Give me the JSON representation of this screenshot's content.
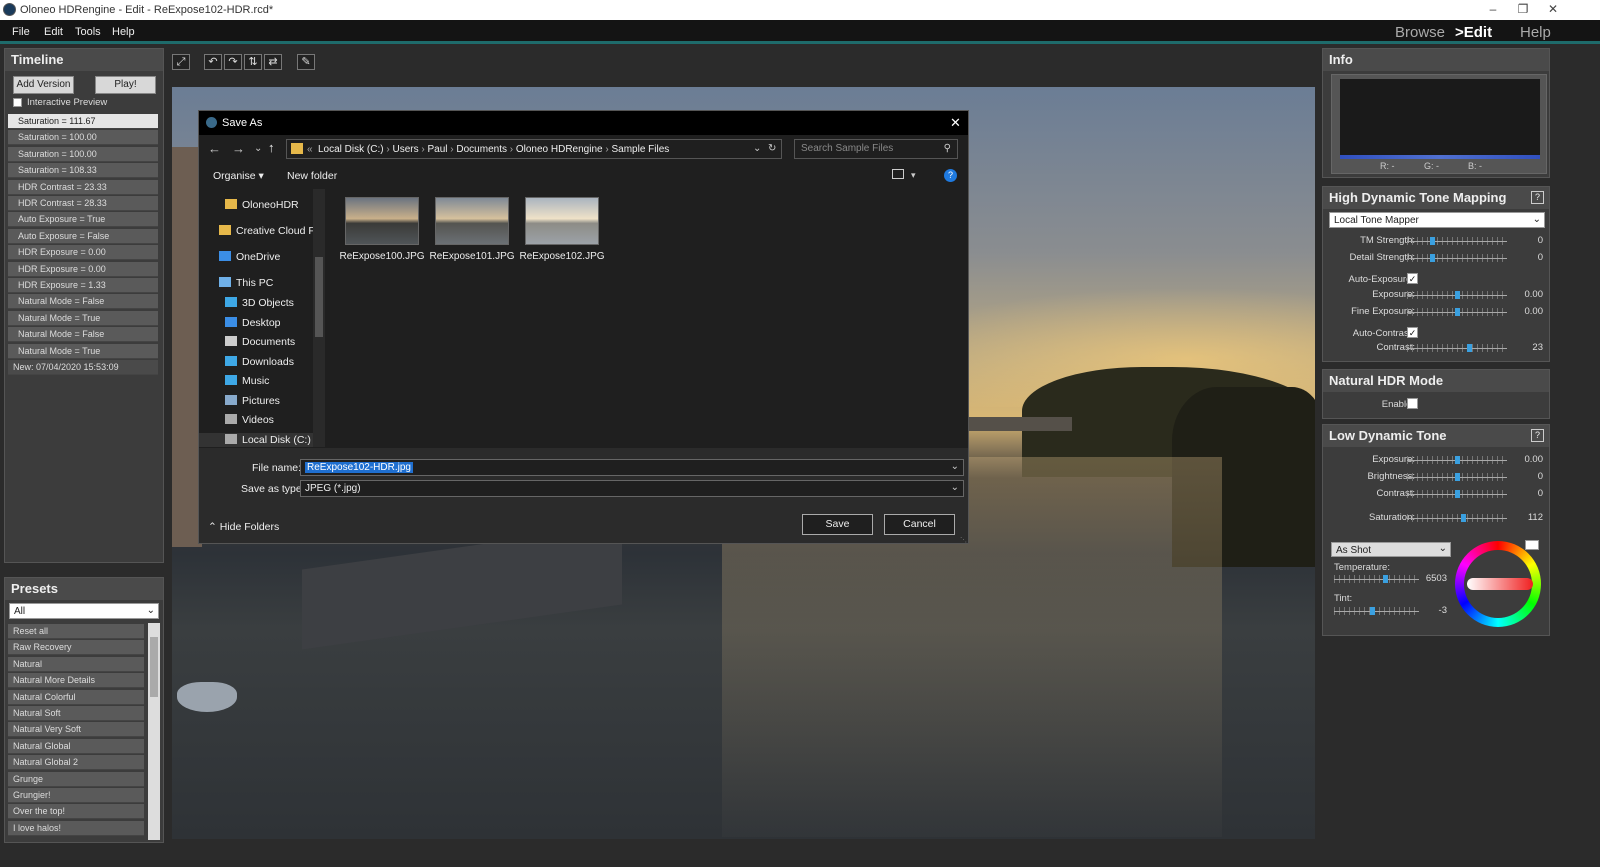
{
  "window": {
    "title": "Oloneo HDRengine - Edit - ReExpose102-HDR.rcd*"
  },
  "menu": {
    "items": [
      "File",
      "Edit",
      "Tools",
      "Help"
    ]
  },
  "modes": {
    "browse": "Browse",
    "edit": ">Edit",
    "help": "Help"
  },
  "timeline": {
    "title": "Timeline",
    "add_version": "Add Version",
    "play": "Play!",
    "interactive_preview": "Interactive Preview",
    "items": [
      "Saturation = 111.67",
      "Saturation = 100.00",
      "Saturation = 100.00",
      "Saturation = 108.33",
      "HDR Contrast = 23.33",
      "HDR Contrast = 28.33",
      "Auto Exposure = True",
      "Auto Exposure = False",
      "HDR Exposure = 0.00",
      "HDR Exposure = 0.00",
      "HDR Exposure = 1.33",
      "Natural Mode = False",
      "Natural Mode = True",
      "Natural Mode = False",
      "Natural Mode = True",
      "New: 07/04/2020 15:53:09"
    ]
  },
  "presets": {
    "title": "Presets",
    "filter": "All",
    "items": [
      "Reset all",
      "Raw Recovery",
      "Natural",
      "Natural More Details",
      "Natural Colorful",
      "Natural Soft",
      "Natural Very Soft",
      "Natural Global",
      "Natural Global 2",
      "Grunge",
      "Grungier!",
      "Over the top!",
      "I love halos!"
    ]
  },
  "dialog": {
    "title": "Save As",
    "breadcrumb": [
      "Local Disk (C:)",
      "Users",
      "Paul",
      "Documents",
      "Oloneo HDRengine",
      "Sample Files"
    ],
    "search_placeholder": "Search Sample Files",
    "organise": "Organise",
    "new_folder": "New folder",
    "nav": [
      "OloneoHDR",
      "Creative Cloud Fil",
      "OneDrive",
      "This PC",
      "3D Objects",
      "Desktop",
      "Documents",
      "Downloads",
      "Music",
      "Pictures",
      "Videos",
      "Local Disk (C:)"
    ],
    "files": [
      "ReExpose100.JPG",
      "ReExpose101.JPG",
      "ReExpose102.JPG"
    ],
    "file_name_label": "File name:",
    "file_name": "ReExpose102-HDR.jpg",
    "save_type_label": "Save as type:",
    "save_type": "JPEG (*.jpg)",
    "hide_folders": "Hide Folders",
    "save": "Save",
    "cancel": "Cancel"
  },
  "info": {
    "title": "Info",
    "r": "R: -",
    "g": "G: -",
    "b": "B: -"
  },
  "hdtm": {
    "title": "High Dynamic Tone Mapping",
    "mapper": "Local Tone Mapper",
    "tm_strength": {
      "label": "TM Strength:",
      "value": "0",
      "pos": 0.25
    },
    "detail_strength": {
      "label": "Detail Strength:",
      "value": "0",
      "pos": 0.25
    },
    "auto_exposure": "Auto-Exposure:",
    "exposure": {
      "label": "Exposure:",
      "value": "0.00",
      "pos": 0.5
    },
    "fine_exposure": {
      "label": "Fine Exposure:",
      "value": "0.00",
      "pos": 0.5
    },
    "auto_contrast": "Auto-Contrast:",
    "contrast": {
      "label": "Contrast:",
      "value": "23",
      "pos": 0.62
    }
  },
  "natural": {
    "title": "Natural HDR Mode",
    "enable": "Enable:"
  },
  "ldt": {
    "title": "Low Dynamic Tone",
    "exposure": {
      "label": "Exposure:",
      "value": "0.00",
      "pos": 0.5
    },
    "brightness": {
      "label": "Brightness:",
      "value": "0",
      "pos": 0.5
    },
    "contrast": {
      "label": "Contrast:",
      "value": "0",
      "pos": 0.5
    },
    "saturation": {
      "label": "Saturation:",
      "value": "112",
      "pos": 0.56
    },
    "wb_preset": "As Shot",
    "temperature": {
      "label": "Temperature:",
      "value": "6503",
      "pos": 0.6
    },
    "tint": {
      "label": "Tint:",
      "value": "-3",
      "pos": 0.45
    }
  },
  "colors": {
    "accent": "#1e6b6b",
    "panel": "#3c3c3c",
    "selection": "#3aa0e0"
  }
}
